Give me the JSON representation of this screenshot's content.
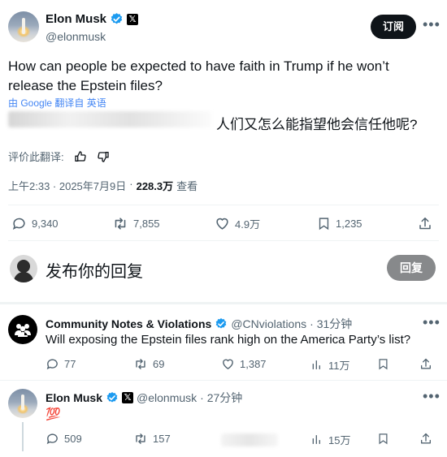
{
  "post": {
    "author_name": "Elon Musk",
    "author_handle": "@elonmusk",
    "subscribe_label": "订阅",
    "text": "How can people be expected to have faith in Trump if he won’t release the Epstein files?",
    "translate_by": "由 Google 翻译自 英语",
    "translation": "人们又怎么能指望他会信任他呢?",
    "rate_translation": "评价此翻译:",
    "time": "上午2:33 · 2025年7月9日",
    "views_count": "228.3万",
    "views_label": "查看",
    "stats": {
      "replies": "9,340",
      "reposts": "7,855",
      "likes": "4.9万",
      "bookmarks": "1,235"
    }
  },
  "composer": {
    "placeholder": "发布你的回复",
    "reply_button": "回复"
  },
  "replies": [
    {
      "author_name": "Community Notes & Violations",
      "author_handle": "@CNviolations",
      "time": "· 31分钟",
      "text": "Will exposing the Epstein files rank high on the America Party’s list?",
      "stats": {
        "replies": "77",
        "reposts": "69",
        "likes": "1,387",
        "views": "11万"
      }
    },
    {
      "author_name": "Elon Musk",
      "author_handle": "@elonmusk",
      "time": "· 27分钟",
      "text": "💯",
      "stats": {
        "replies": "509",
        "reposts": "157",
        "views": "15万"
      }
    }
  ],
  "colors": {
    "verified": "#1d9bf0",
    "text": "#0f1419",
    "secondary": "#536471"
  }
}
